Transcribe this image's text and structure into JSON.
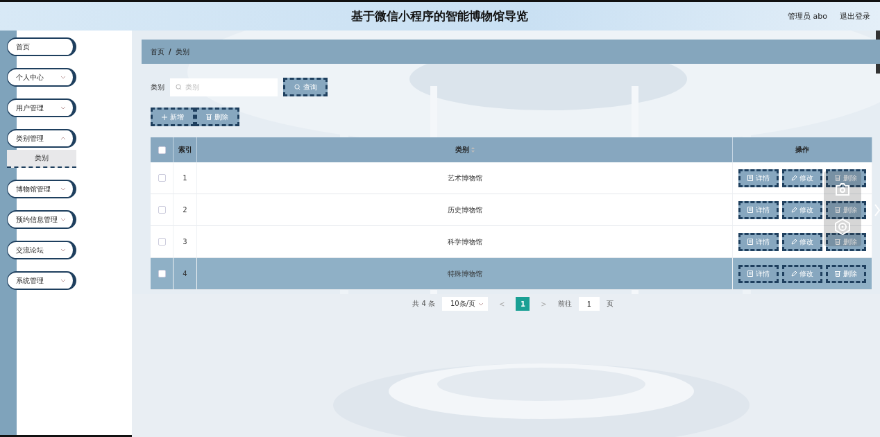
{
  "header": {
    "title": "基于微信小程序的智能博物馆导览",
    "user": "管理员 abo",
    "logout": "退出登录"
  },
  "sidebar": {
    "items": [
      {
        "label": "首页",
        "kind": "link"
      },
      {
        "label": "个人中心",
        "kind": "submenu"
      },
      {
        "label": "用户管理",
        "kind": "submenu"
      },
      {
        "label": "类别管理",
        "kind": "submenu",
        "expanded": true,
        "children": [
          {
            "label": "类别",
            "selected": true
          }
        ]
      },
      {
        "label": "博物馆管理",
        "kind": "submenu"
      },
      {
        "label": "预约信息管理",
        "kind": "submenu"
      },
      {
        "label": "交流论坛",
        "kind": "submenu"
      },
      {
        "label": "系统管理",
        "kind": "submenu"
      }
    ]
  },
  "breadcrumb": [
    "首页",
    "/",
    "类别"
  ],
  "search": {
    "label": "类别",
    "placeholder": "类别",
    "button": "查询"
  },
  "toolbar": [
    {
      "label": "新增",
      "kind": "add"
    },
    {
      "label": "删除",
      "kind": "delete"
    }
  ],
  "table": {
    "all_checked": false,
    "columns": [
      "",
      "索引",
      "类别",
      "操作"
    ],
    "rows": [
      {
        "checked": false,
        "highlighted": false,
        "index": "1",
        "category": "艺术博物馆",
        "actions": [
          "详情",
          "修改",
          "删除"
        ]
      },
      {
        "checked": false,
        "highlighted": false,
        "index": "2",
        "category": "历史博物馆",
        "actions": [
          "详情",
          "修改",
          "删除"
        ]
      },
      {
        "checked": false,
        "highlighted": false,
        "index": "3",
        "category": "科学博物馆",
        "actions": [
          "详情",
          "修改",
          "删除"
        ]
      },
      {
        "checked": false,
        "highlighted": true,
        "index": "4",
        "category": "特殊博物馆",
        "actions": [
          "详情",
          "修改",
          "删除"
        ]
      }
    ]
  },
  "pagination": {
    "total": "共 4 条",
    "page_size": "10条/页",
    "prev": "<",
    "pages": [
      {
        "label": "1",
        "selected": true
      }
    ],
    "next": ">",
    "goto": "前往",
    "goto_value": "1",
    "page_word": "页"
  }
}
